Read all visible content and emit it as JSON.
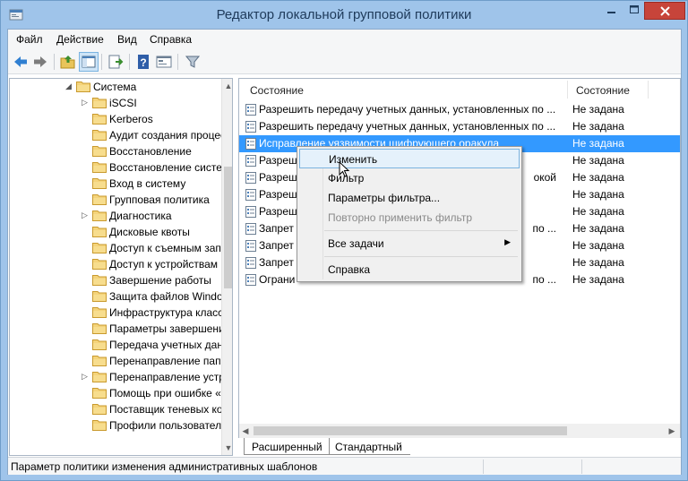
{
  "window": {
    "title": "Редактор локальной групповой политики"
  },
  "menubar": {
    "items": [
      "Файл",
      "Действие",
      "Вид",
      "Справка"
    ]
  },
  "toolbar": {
    "buttons": [
      "back-icon",
      "forward-icon",
      "up-folder-icon",
      "show-hide-tree-icon",
      "export-list-icon",
      "help-icon",
      "properties-icon",
      "filter-icon"
    ]
  },
  "tree": {
    "items": [
      {
        "label": "Система",
        "expanded": true
      },
      {
        "label": "iSCSI",
        "expandable": true
      },
      {
        "label": "Kerberos"
      },
      {
        "label": "Аудит создания процесс"
      },
      {
        "label": "Восстановление"
      },
      {
        "label": "Восстановление систем"
      },
      {
        "label": "Вход в систему"
      },
      {
        "label": "Групповая политика"
      },
      {
        "label": "Диагностика",
        "expandable": true
      },
      {
        "label": "Дисковые квоты"
      },
      {
        "label": "Доступ к съемным запо"
      },
      {
        "label": "Доступ к устройствам E"
      },
      {
        "label": "Завершение работы"
      },
      {
        "label": "Защита файлов Window"
      },
      {
        "label": "Инфраструктура класси"
      },
      {
        "label": "Параметры завершения"
      },
      {
        "label": "Передача учетных данн"
      },
      {
        "label": "Перенаправление папо"
      },
      {
        "label": "Перенаправление устро",
        "expandable": true
      },
      {
        "label": "Помощь при ошибке «"
      },
      {
        "label": "Поставщик теневых коп"
      },
      {
        "label": "Профили пользователе"
      }
    ]
  },
  "list": {
    "columns": [
      "Состояние",
      "Состояние"
    ],
    "rows": [
      {
        "name": "Разрешить передачу учетных данных, установленных по ...",
        "state": "Не задана"
      },
      {
        "name": "Разрешить передачу учетных данных, установленных по ...",
        "state": "Не задана"
      },
      {
        "name": "Исправление уязвимости шифрующего оракула",
        "state": "Не задана",
        "selected": true
      },
      {
        "name": "Разреш",
        "state": "Не задана"
      },
      {
        "name": "Разреш",
        "suffix": "окой",
        "state": "Не задана"
      },
      {
        "name": "Разреш",
        "state": "Не задана"
      },
      {
        "name": "Разреш",
        "state": "Не задана"
      },
      {
        "name": "Запрет",
        "suffix": "по ...",
        "state": "Не задана"
      },
      {
        "name": "Запрет",
        "state": "Не задана"
      },
      {
        "name": "Запрет",
        "state": "Не задана"
      },
      {
        "name": "Ограни",
        "suffix": "по ...",
        "state": "Не задана"
      }
    ]
  },
  "tabs": {
    "extended": "Расширенный",
    "standard": "Стандартный"
  },
  "status": {
    "text": "Параметр политики изменения административных шаблонов"
  },
  "context_menu": {
    "items": [
      {
        "label": "Изменить",
        "hover": true
      },
      {
        "label": "Фильтр"
      },
      {
        "label": "Параметры фильтра..."
      },
      {
        "label": "Повторно применить фильтр",
        "disabled": true
      },
      {
        "label": "Все задачи",
        "submenu": true
      },
      {
        "label": "Справка"
      }
    ]
  },
  "colors": {
    "title_bar": "#9fc4ea",
    "selection": "#3399ff",
    "close_button": "#c7443a"
  }
}
